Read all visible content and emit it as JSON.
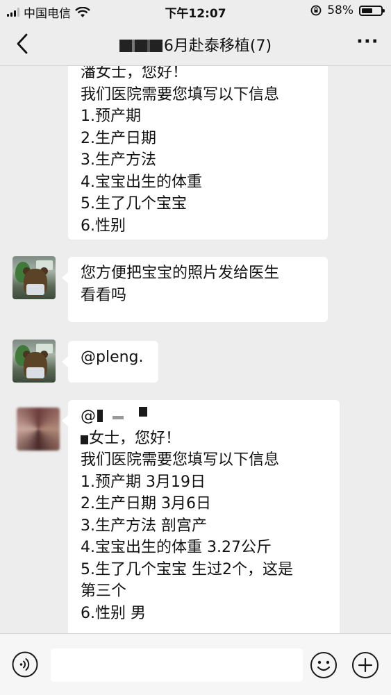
{
  "status_bar": {
    "carrier": "中国电信",
    "time": "下午12:07",
    "battery_percent": "58%",
    "battery_level": 0.58
  },
  "nav": {
    "title": "6月赴泰移植(7)",
    "more_label": "···"
  },
  "messages": [
    {
      "lines": [
        "潘女士，您好！",
        "我们医院需要您填写以下信息",
        "1.预产期",
        "2.生产日期",
        "3.生产方法",
        "4.宝宝出生的体重",
        "5.生了几个宝宝",
        "6.性别"
      ]
    },
    {
      "lines": [
        "您方便把宝宝的照片发给医生",
        "看看吗"
      ]
    },
    {
      "lines": [
        "@pleng."
      ]
    },
    {
      "lines": [
        "@",
        "女士，您好！",
        "我们医院需要您填写以下信息",
        "1.预产期  3月19日",
        "2.生产日期 3月6日",
        "3.生产方法 剖宫产",
        "4.宝宝出生的体重 3.27公斤",
        "5.生了几个宝宝 生过2个，这是",
        "第三个",
        "6.性别 男"
      ]
    }
  ],
  "input": {
    "placeholder": ""
  },
  "colors": {
    "background": "#ededed",
    "bubble": "#ffffff",
    "input_bar": "#f6f6f6"
  }
}
